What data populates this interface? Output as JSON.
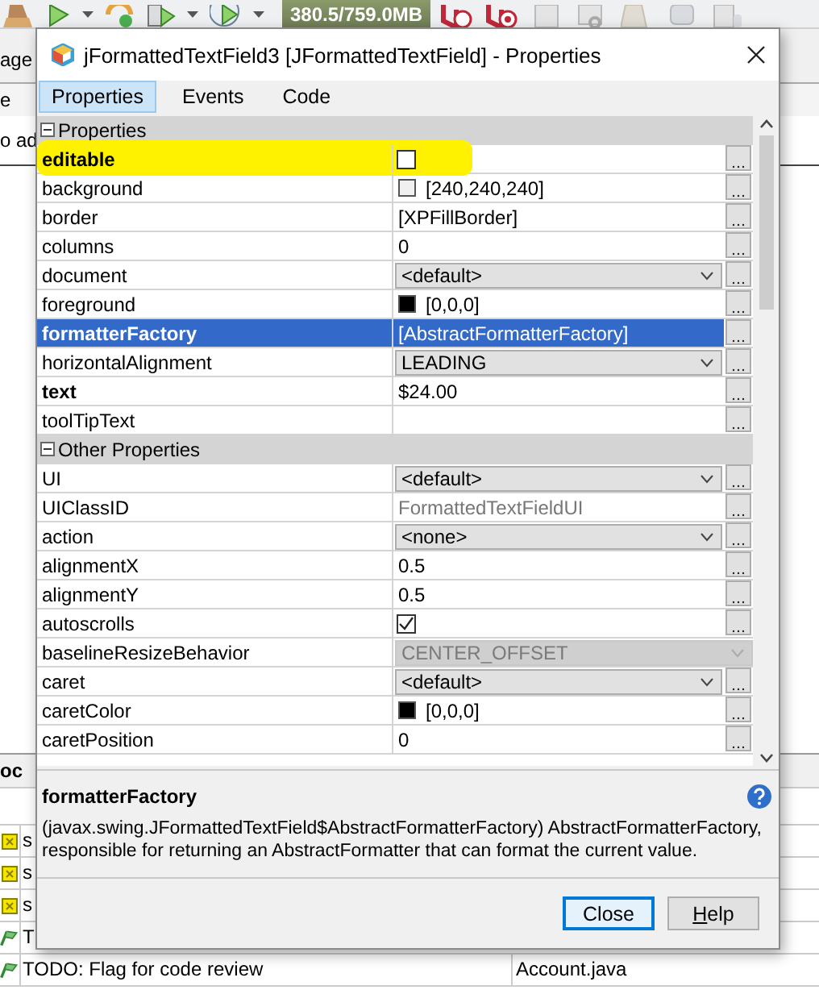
{
  "ide": {
    "toolbar": {
      "memory": "380.5/759.0MB"
    },
    "left_fragments": [
      "age",
      "e",
      "o ad"
    ],
    "bottom": {
      "header": "oc",
      "rows": [
        {
          "kind": "task",
          "text": "s"
        },
        {
          "kind": "task",
          "text": "s"
        },
        {
          "kind": "task",
          "text": "s"
        },
        {
          "kind": "todo",
          "text": "T"
        },
        {
          "kind": "todo",
          "text": "TODO: Flag for code review",
          "file": "Account.java"
        }
      ]
    }
  },
  "dialog": {
    "title": "jFormattedTextField3 [JFormattedTextField] - Properties",
    "tabs": [
      {
        "label": "Properties",
        "selected": true
      },
      {
        "label": "Events",
        "selected": false
      },
      {
        "label": "Code",
        "selected": false
      }
    ],
    "sheet": {
      "rows": [
        {
          "kind": "category",
          "name": "Properties",
          "expanded": true
        },
        {
          "kind": "checkbox",
          "name": "editable",
          "bold": true,
          "selected": false,
          "highlighted": true,
          "checked": false
        },
        {
          "kind": "color",
          "name": "background",
          "bold": false,
          "selected": false,
          "highlighted": false,
          "color": "#f0f0f0",
          "value": "[240,240,240]"
        },
        {
          "kind": "text",
          "name": "border",
          "bold": false,
          "selected": false,
          "highlighted": false,
          "value": "[XPFillBorder]"
        },
        {
          "kind": "text",
          "name": "columns",
          "bold": false,
          "selected": false,
          "highlighted": false,
          "value": "0"
        },
        {
          "kind": "combo",
          "name": "document",
          "bold": false,
          "selected": false,
          "highlighted": false,
          "value": "<default>"
        },
        {
          "kind": "color",
          "name": "foreground",
          "bold": false,
          "selected": false,
          "highlighted": false,
          "color": "#000000",
          "value": "[0,0,0]"
        },
        {
          "kind": "text",
          "name": "formatterFactory",
          "bold": true,
          "selected": true,
          "highlighted": false,
          "value": "[AbstractFormatterFactory]"
        },
        {
          "kind": "combo",
          "name": "horizontalAlignment",
          "bold": false,
          "selected": false,
          "highlighted": false,
          "value": "LEADING"
        },
        {
          "kind": "text",
          "name": "text",
          "bold": true,
          "selected": false,
          "highlighted": false,
          "value": "$24.00"
        },
        {
          "kind": "text",
          "name": "toolTipText",
          "bold": false,
          "selected": false,
          "highlighted": false
        },
        {
          "kind": "category",
          "name": "Other Properties",
          "expanded": true
        },
        {
          "kind": "combo",
          "name": "UI",
          "bold": false,
          "selected": false,
          "highlighted": false,
          "value": "<default>"
        },
        {
          "kind": "readonly",
          "name": "UIClassID",
          "bold": false,
          "selected": false,
          "highlighted": false,
          "value": "FormattedTextFieldUI"
        },
        {
          "kind": "combo",
          "name": "action",
          "bold": false,
          "selected": false,
          "highlighted": false,
          "value": "<none>"
        },
        {
          "kind": "text",
          "name": "alignmentX",
          "bold": false,
          "selected": false,
          "highlighted": false,
          "value": "0.5"
        },
        {
          "kind": "text",
          "name": "alignmentY",
          "bold": false,
          "selected": false,
          "highlighted": false,
          "value": "0.5"
        },
        {
          "kind": "checkbox",
          "name": "autoscrolls",
          "bold": false,
          "selected": false,
          "highlighted": false,
          "checked": true
        },
        {
          "kind": "disabled_combo",
          "name": "baselineResizeBehavior",
          "bold": false,
          "selected": false,
          "highlighted": false,
          "value": "CENTER_OFFSET"
        },
        {
          "kind": "combo",
          "name": "caret",
          "bold": false,
          "selected": false,
          "highlighted": false,
          "value": "<default>"
        },
        {
          "kind": "color",
          "name": "caretColor",
          "bold": false,
          "selected": false,
          "highlighted": false,
          "color": "#000000",
          "value": "[0,0,0]"
        },
        {
          "kind": "text",
          "name": "caretPosition",
          "bold": false,
          "selected": false,
          "highlighted": false,
          "value": "0"
        }
      ]
    },
    "description": {
      "title": "formatterFactory",
      "text": "(javax.swing.JFormattedTextField$AbstractFormatterFactory) AbstractFormatterFactory, responsible for returning an AbstractFormatter that can format the current value."
    },
    "buttons": [
      {
        "label": "Close",
        "focused": true,
        "mnemonic_underlined": false
      },
      {
        "label": "Help",
        "focused": false,
        "mnemonic_underlined": true
      }
    ]
  }
}
